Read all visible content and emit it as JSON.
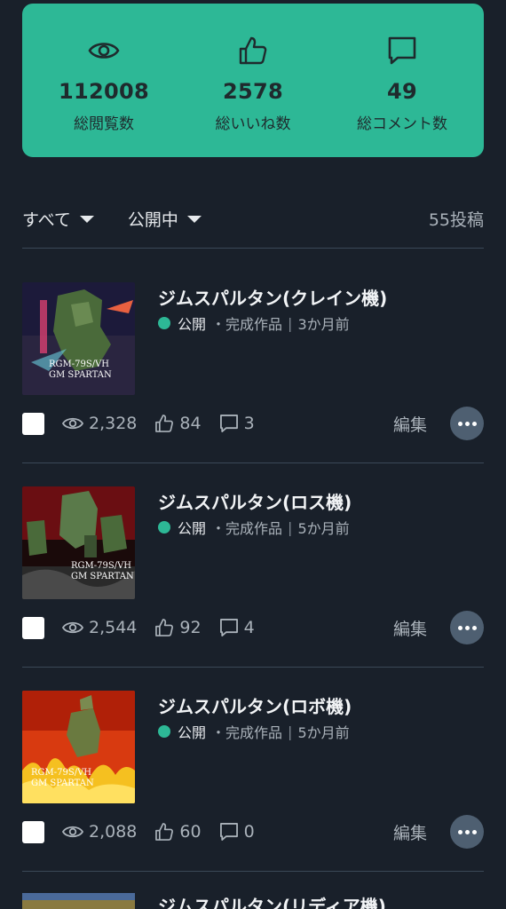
{
  "stats": [
    {
      "icon": "eye-icon",
      "value": "112008",
      "label": "総閲覧数"
    },
    {
      "icon": "thumbs-up-icon",
      "value": "2578",
      "label": "総いいね数"
    },
    {
      "icon": "comment-icon",
      "value": "49",
      "label": "総コメント数"
    }
  ],
  "filters": {
    "category_label": "すべて",
    "status_label": "公開中",
    "post_count": "55投稿"
  },
  "posts": [
    {
      "title": "ジムスパルタン(クレイン機)",
      "status": "公開",
      "category": "完成作品",
      "time": "3か月前",
      "views": "2,328",
      "likes": "84",
      "comments": "3",
      "thumb_text": [
        "RGM-79S/VH",
        "GM SPARTAN"
      ],
      "edit_label": "編集"
    },
    {
      "title": "ジムスパルタン(ロス機)",
      "status": "公開",
      "category": "完成作品",
      "time": "5か月前",
      "views": "2,544",
      "likes": "92",
      "comments": "4",
      "thumb_text": [
        "RGM-79S/VH",
        "GM SPARTAN"
      ],
      "edit_label": "編集"
    },
    {
      "title": "ジムスパルタン(ロボ機)",
      "status": "公開",
      "category": "完成作品",
      "time": "5か月前",
      "views": "2,088",
      "likes": "60",
      "comments": "0",
      "thumb_text": [
        "RGM-79S/VH",
        "GM SPARTAN"
      ],
      "edit_label": "編集"
    }
  ],
  "partial_post": {
    "title": "ジムスパルタン(リディア機)"
  }
}
